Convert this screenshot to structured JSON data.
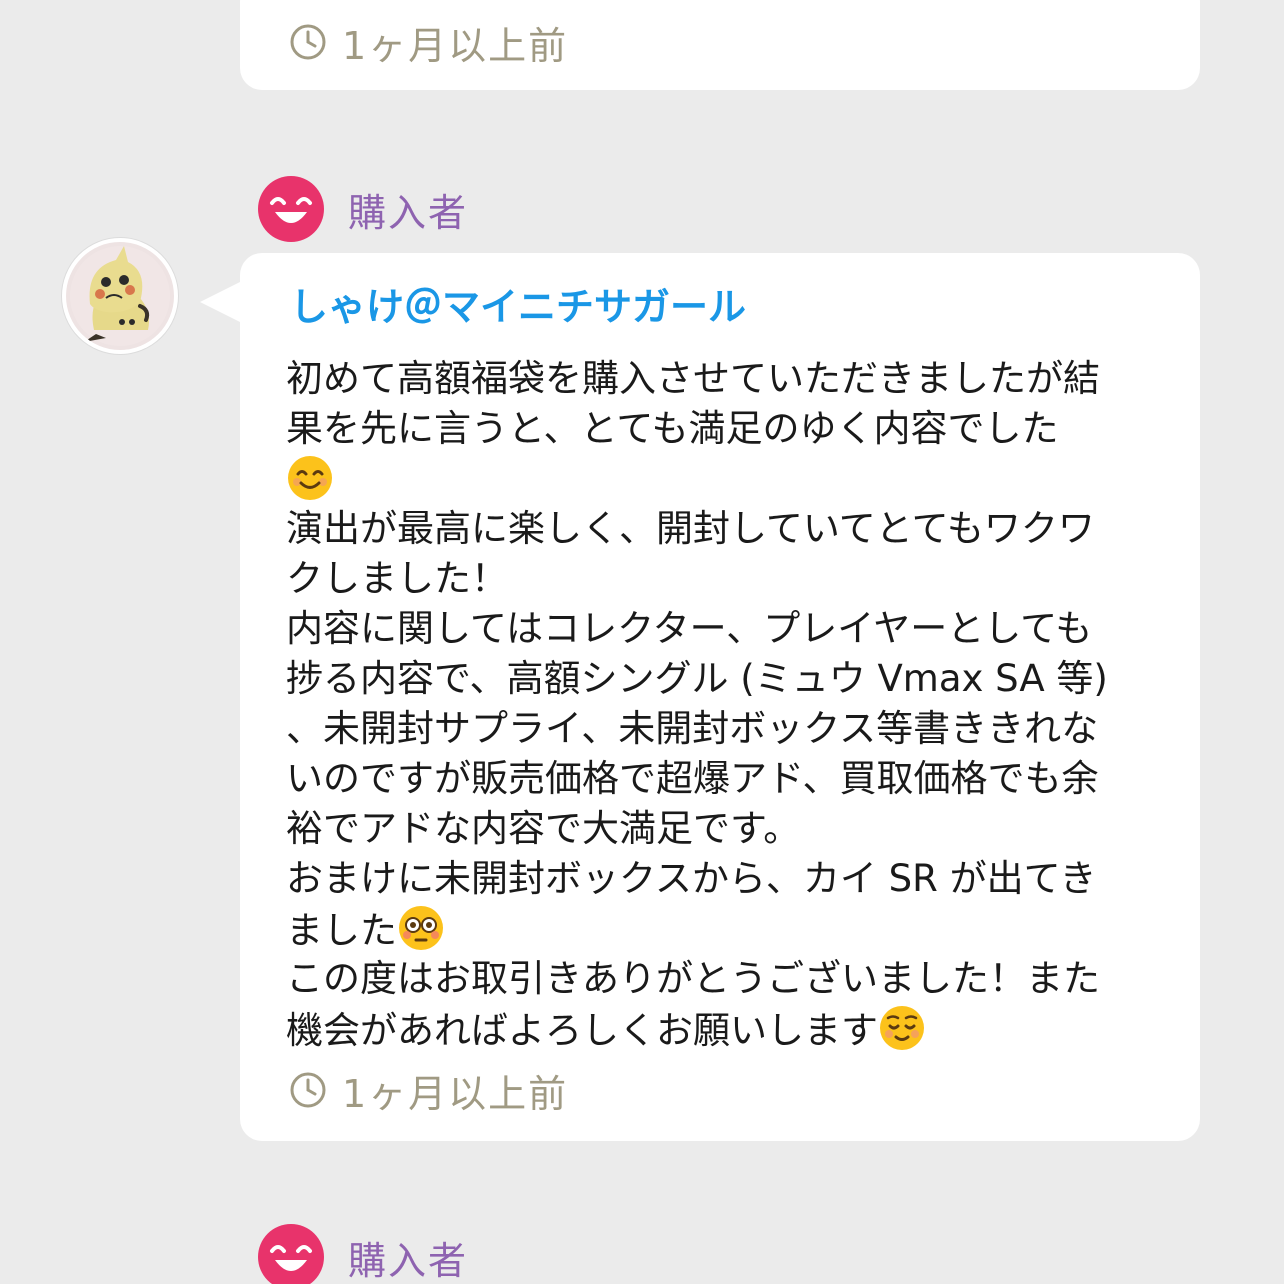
{
  "previous_review": {
    "timestamp": "1ヶ月以上前"
  },
  "review": {
    "role_label": "購入者",
    "role_icon": "smiling-face-icon",
    "reviewer_name": "しゃけ＠マイニチサガール",
    "body_lines": [
      "初めて高額福袋を購入させていただきましたが結",
      "果を先に言うと、とても満足のゆく内容でした",
      "演出が最高に楽しく、開封していてとてもワクワ",
      "クしました！",
      "内容に関してはコレクター、プレイヤーとしても",
      "捗る内容で、高額シングル (ミュウ Vmax SA 等)",
      "、未開封サプライ、未開封ボックス等書ききれな",
      "いのですが販売価格で超爆アド、買取価格でも余",
      "裕でアドな内容で大満足です。",
      "おまけに未開封ボックスから、カイ SR が出てき",
      "ました",
      "この度はお取引きありがとうございました！また",
      "機会があればよろしくお願いします"
    ],
    "emojis": [
      "smiling-face-emoji",
      "flushed-face-emoji",
      "relieved-face-emoji"
    ],
    "timestamp": "1ヶ月以上前"
  },
  "next_review": {
    "role_label": "購入者"
  },
  "colors": {
    "background": "#ebebeb",
    "card": "#ffffff",
    "reviewer_name": "#1a97e6",
    "buyer_label": "#8e63b0",
    "buyer_icon": "#e8336b",
    "timestamp": "#a09a83"
  }
}
